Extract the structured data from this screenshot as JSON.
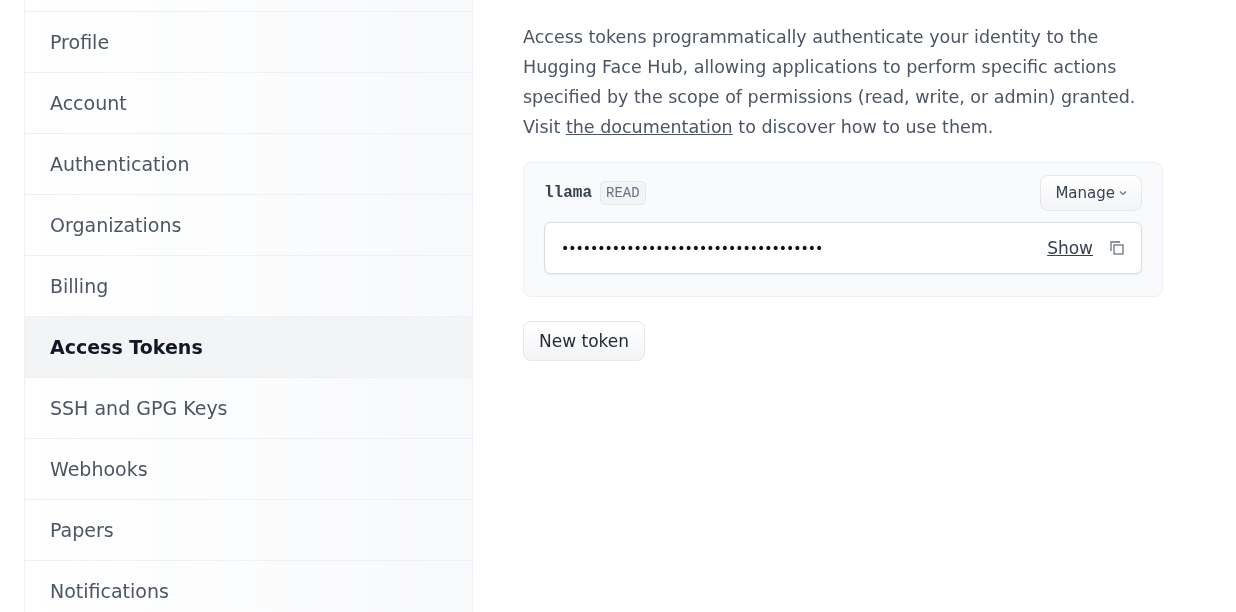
{
  "sidebar": {
    "items": [
      {
        "label": "Profile",
        "selected": false
      },
      {
        "label": "Account",
        "selected": false
      },
      {
        "label": "Authentication",
        "selected": false
      },
      {
        "label": "Organizations",
        "selected": false
      },
      {
        "label": "Billing",
        "selected": false
      },
      {
        "label": "Access Tokens",
        "selected": true
      },
      {
        "label": "SSH and GPG Keys",
        "selected": false
      },
      {
        "label": "Webhooks",
        "selected": false
      },
      {
        "label": "Papers",
        "selected": false
      },
      {
        "label": "Notifications",
        "selected": false
      }
    ]
  },
  "description": {
    "text": "Access tokens programmatically authenticate your identity to the Hugging Face Hub, allowing applications to perform specific actions specified by the scope of permissions (read, write, or admin) granted. Visit",
    "link": "the documentation",
    "after": "to discover how to use them."
  },
  "tokens": [
    {
      "name": "llama",
      "role": "READ",
      "manage": "Manage",
      "value": "••••••••••••••••••••••••••••••••••••",
      "show": "Show"
    }
  ],
  "new_token_button": "New token"
}
